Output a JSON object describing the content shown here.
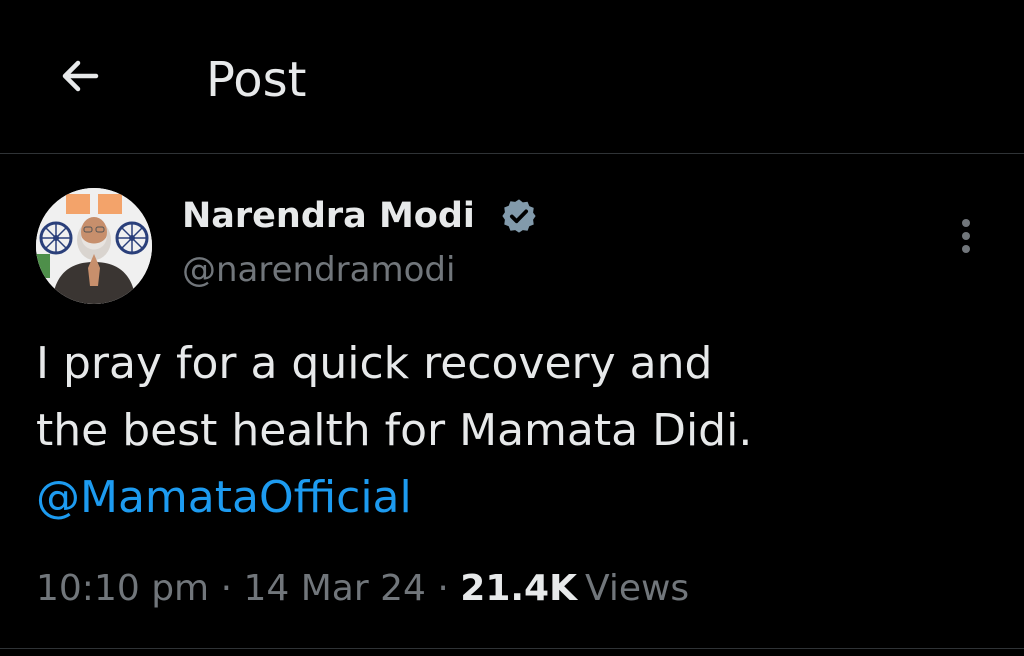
{
  "header": {
    "title": "Post",
    "back_icon": "arrow-left-icon"
  },
  "author": {
    "display_name": "Narendra Modi",
    "handle": "@narendramodi",
    "verified": true,
    "verified_icon": "verified-badge-icon"
  },
  "post": {
    "text_lines": [
      "I pray for a quick recovery and",
      "the best health for Mamata Didi."
    ],
    "mention": "@MamataOfficial",
    "time": "10:10 pm",
    "separator": "·",
    "date": "14 Mar 24",
    "views_count": "21.4K",
    "views_label": "Views"
  },
  "menu": {
    "icon": "more-vertical-icon"
  },
  "colors": {
    "background": "#000000",
    "text_primary": "#e7e9ea",
    "text_secondary": "#71767b",
    "accent": "#1d9bf0",
    "divider": "#2f3336",
    "verified_badge": "#829aab"
  }
}
